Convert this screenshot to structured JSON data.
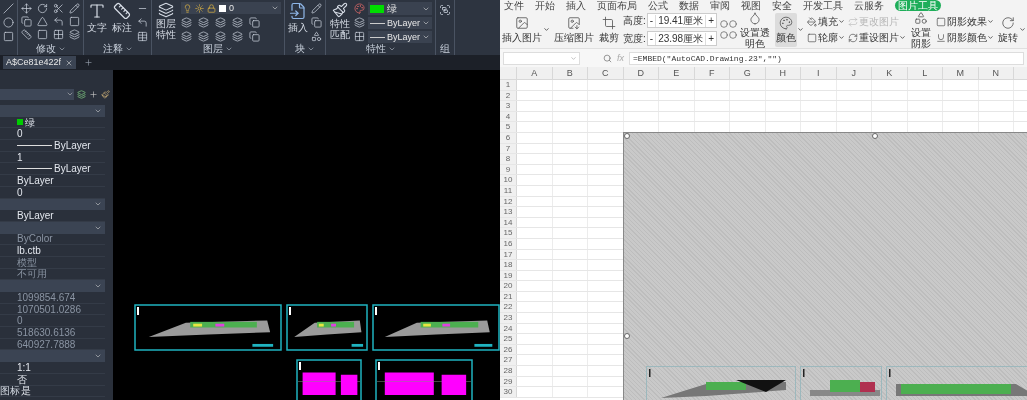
{
  "cad": {
    "ribbon_groups": [
      {
        "kind": "draw"
      },
      {
        "kind": "modify",
        "label": "修改"
      },
      {
        "kind": "annotate",
        "label": "注释",
        "buttons": [
          "文字",
          "标注"
        ]
      },
      {
        "kind": "layers",
        "label": "图层",
        "buttons": [
          "图层特性"
        ],
        "layer": "0"
      },
      {
        "kind": "block",
        "label": "块",
        "buttons": [
          "插入"
        ]
      },
      {
        "kind": "properties",
        "label": "特性",
        "buttons": [
          "特性匹配"
        ],
        "color": {
          "value": "绿",
          "color": "#00dd00"
        },
        "lines": [
          "ByLayer",
          "ByLayer"
        ]
      },
      {
        "kind": "group",
        "label": "组"
      }
    ],
    "file_tabs": [
      {
        "label": "A$Ce81e422f",
        "selected": true
      }
    ],
    "properties": {
      "sections": [
        {
          "rows": [
            {
              "kind": "color",
              "value": "绿",
              "color": "#00cc00",
              "disabled": false
            },
            {
              "kind": "text",
              "value": "0",
              "disabled": false
            },
            {
              "kind": "line",
              "value": "ByLayer",
              "disabled": false
            },
            {
              "kind": "text",
              "value": "1",
              "disabled": false
            },
            {
              "kind": "line",
              "value": "ByLayer",
              "disabled": false
            },
            {
              "kind": "text",
              "value": "ByLayer",
              "disabled": false
            },
            {
              "kind": "text",
              "value": "0",
              "disabled": false
            }
          ]
        },
        {
          "rows": [
            {
              "kind": "text",
              "value": "ByLayer",
              "disabled": false
            }
          ]
        },
        {
          "rows": [
            {
              "kind": "text",
              "value": "ByColor",
              "disabled": true
            },
            {
              "kind": "text",
              "value": "lb.ctb",
              "disabled": false
            },
            {
              "kind": "text",
              "value": "模型",
              "disabled": true
            },
            {
              "kind": "text",
              "value": "不可用",
              "disabled": true
            }
          ]
        },
        {
          "rows": [
            {
              "kind": "text",
              "value": "1099854.674",
              "disabled": true
            },
            {
              "kind": "text",
              "value": "1070501.0286",
              "disabled": true
            },
            {
              "kind": "text",
              "value": "0",
              "disabled": true
            },
            {
              "kind": "text",
              "value": "518630.6136",
              "disabled": true
            },
            {
              "kind": "text",
              "value": "640927.7888",
              "disabled": true
            }
          ]
        },
        {
          "rows": [
            {
              "kind": "text",
              "value": "1:1",
              "disabled": false
            },
            {
              "kind": "text",
              "value": "否",
              "disabled": false
            },
            {
              "kind": "text",
              "value": "是",
              "label": "图标",
              "disabled": false
            }
          ]
        }
      ]
    }
  },
  "sheet": {
    "menu_tabs": [
      {
        "label": "文件",
        "selected": false
      },
      {
        "label": "开始",
        "selected": false
      },
      {
        "label": "插入",
        "selected": false
      },
      {
        "label": "页面布局",
        "selected": false
      },
      {
        "label": "公式",
        "selected": false
      },
      {
        "label": "数据",
        "selected": false
      },
      {
        "label": "审阅",
        "selected": false
      },
      {
        "label": "视图",
        "selected": false
      },
      {
        "label": "安全",
        "selected": false
      },
      {
        "label": "开发工具",
        "selected": false
      },
      {
        "label": "云服务",
        "selected": false
      },
      {
        "label": "图片工具",
        "selected": true
      }
    ],
    "ribbon": [
      {
        "kind": "big",
        "label": "插入图片",
        "caret": true
      },
      {
        "kind": "big",
        "label": "压缩图片",
        "caret": false
      },
      {
        "kind": "big",
        "label": "裁剪",
        "caret": false
      },
      {
        "kind": "size",
        "fields": [
          {
            "label": "高度:",
            "value": "19.41厘米",
            "minus": "-",
            "plus": "+"
          },
          {
            "label": "宽度:",
            "value": "23.98厘米",
            "minus": "-",
            "plus": "+"
          }
        ]
      },
      {
        "kind": "iconpair"
      },
      {
        "kind": "big",
        "label": "设置透明色",
        "caret": false
      },
      {
        "kind": "big",
        "label": "颜色",
        "caret": true,
        "selected": true
      },
      {
        "kind": "stack",
        "items": [
          {
            "label": "填充",
            "caret": true,
            "disabled": false
          },
          {
            "label": "轮廓",
            "caret": true,
            "disabled": false
          }
        ]
      },
      {
        "kind": "stack",
        "items": [
          {
            "label": "更改图片",
            "caret": false,
            "disabled": true
          },
          {
            "label": "重设图片",
            "caret": true,
            "disabled": false
          }
        ]
      },
      {
        "kind": "big",
        "label": "设置阴影",
        "caret": false
      },
      {
        "kind": "stack",
        "items": [
          {
            "label": "阴影效果",
            "caret": true,
            "disabled": false
          },
          {
            "label": "阴影颜色",
            "caret": true,
            "disabled": false
          }
        ]
      },
      {
        "kind": "big",
        "label": "旋转",
        "caret": true
      }
    ],
    "fx_label": "fx",
    "formula": "=EMBED(\"AutoCAD.Drawing.23\",\"\")",
    "columns": [
      "A",
      "B",
      "C",
      "D",
      "E",
      "F",
      "G",
      "H",
      "I",
      "J",
      "K",
      "L",
      "M",
      "N"
    ],
    "rows": [
      "1",
      "2",
      "3",
      "4",
      "5",
      "6",
      "7",
      "8",
      "9",
      "10",
      "11",
      "12",
      "13",
      "14",
      "15",
      "16",
      "17",
      "18",
      "19",
      "20",
      "21",
      "22",
      "23",
      "24",
      "25",
      "26",
      "27",
      "28",
      "29",
      "30"
    ]
  }
}
